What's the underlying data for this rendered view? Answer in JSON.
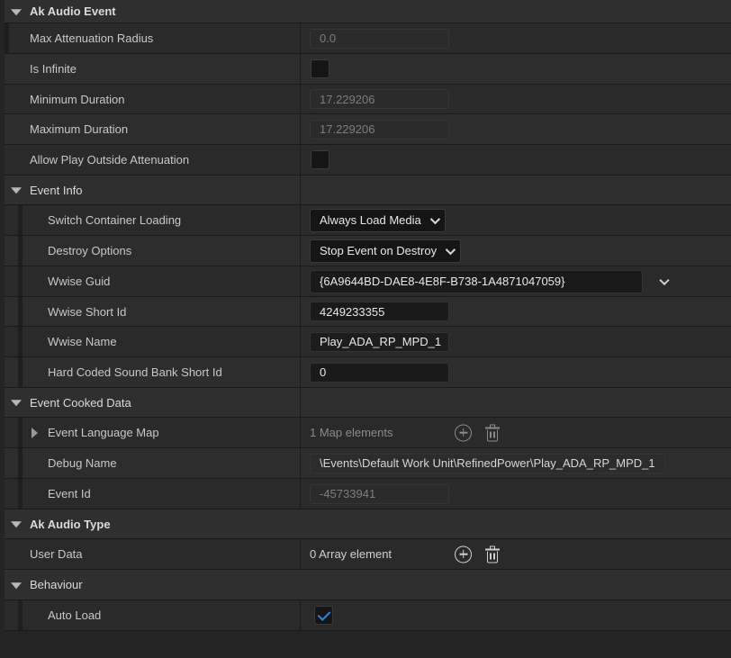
{
  "sections": {
    "ak_audio_event": "Ak Audio Event",
    "event_info": "Event Info",
    "event_cooked_data": "Event Cooked Data",
    "ak_audio_type": "Ak Audio Type",
    "behaviour": "Behaviour"
  },
  "props": {
    "max_attenuation_radius": {
      "label": "Max Attenuation Radius",
      "value": "0.0"
    },
    "is_infinite": {
      "label": "Is Infinite",
      "checked": false
    },
    "minimum_duration": {
      "label": "Minimum Duration",
      "value": "17.229206"
    },
    "maximum_duration": {
      "label": "Maximum Duration",
      "value": "17.229206"
    },
    "allow_play_outside": {
      "label": "Allow Play Outside Attenuation",
      "checked": false
    },
    "switch_container_loading": {
      "label": "Switch Container Loading",
      "value": "Always Load Media"
    },
    "destroy_options": {
      "label": "Destroy Options",
      "value": "Stop Event on Destroy"
    },
    "wwise_guid": {
      "label": "Wwise Guid",
      "value": "{6A9644BD-DAE8-4E8F-B738-1A4871047059}"
    },
    "wwise_short_id": {
      "label": "Wwise Short Id",
      "value": "4249233355"
    },
    "wwise_name": {
      "label": "Wwise Name",
      "value": "Play_ADA_RP_MPD_1"
    },
    "hard_coded_bank_id": {
      "label": "Hard Coded Sound Bank Short Id",
      "value": "0"
    },
    "event_language_map": {
      "label": "Event Language Map",
      "value": "1 Map elements"
    },
    "debug_name": {
      "label": "Debug Name",
      "value": "\\Events\\Default Work Unit\\RefinedPower\\Play_ADA_RP_MPD_1"
    },
    "event_id": {
      "label": "Event Id",
      "value": "-45733941"
    },
    "user_data": {
      "label": "User Data",
      "value": "0 Array element"
    },
    "auto_load": {
      "label": "Auto Load",
      "checked": true
    }
  },
  "colors": {
    "check_accent": "#2b84e8",
    "panel_bg": "#242424"
  }
}
